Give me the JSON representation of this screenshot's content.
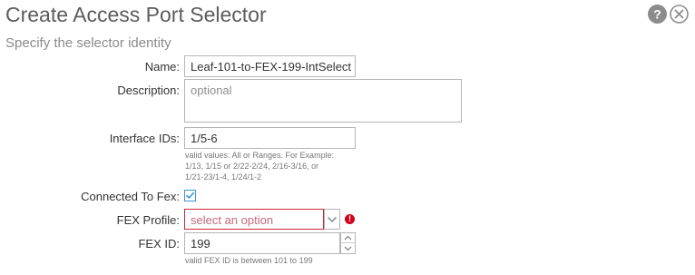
{
  "dialog": {
    "title": "Create Access Port Selector",
    "subtitle": "Specify the selector identity",
    "help_icon": "help-icon",
    "close_icon": "close-icon"
  },
  "form": {
    "name": {
      "label": "Name:",
      "value": "Leaf-101-to-FEX-199-IntSelect"
    },
    "description": {
      "label": "Description:",
      "placeholder": "optional"
    },
    "interface_ids": {
      "label": "Interface IDs:",
      "value": "1/5-6",
      "hint_lines": [
        "valid values: All or Ranges. For Example:",
        "1/13, 1/15 or 2/22-2/24, 2/16-3/16, or",
        "1/21-23/1-4, 1/24/1-2"
      ]
    },
    "connected_to_fex": {
      "label": "Connected To Fex:",
      "checked": true
    },
    "fex_profile": {
      "label": "FEX Profile:",
      "placeholder": "select an option",
      "error_color": "#d0021b",
      "error_mark": "!"
    },
    "fex_id": {
      "label": "FEX ID:",
      "value": "199",
      "hint": "valid FEX ID is between 101 to 199"
    }
  },
  "colors": {
    "accent": "#3a95d6",
    "error": "#d0021b",
    "icon_gray": "#8c8c8c"
  }
}
